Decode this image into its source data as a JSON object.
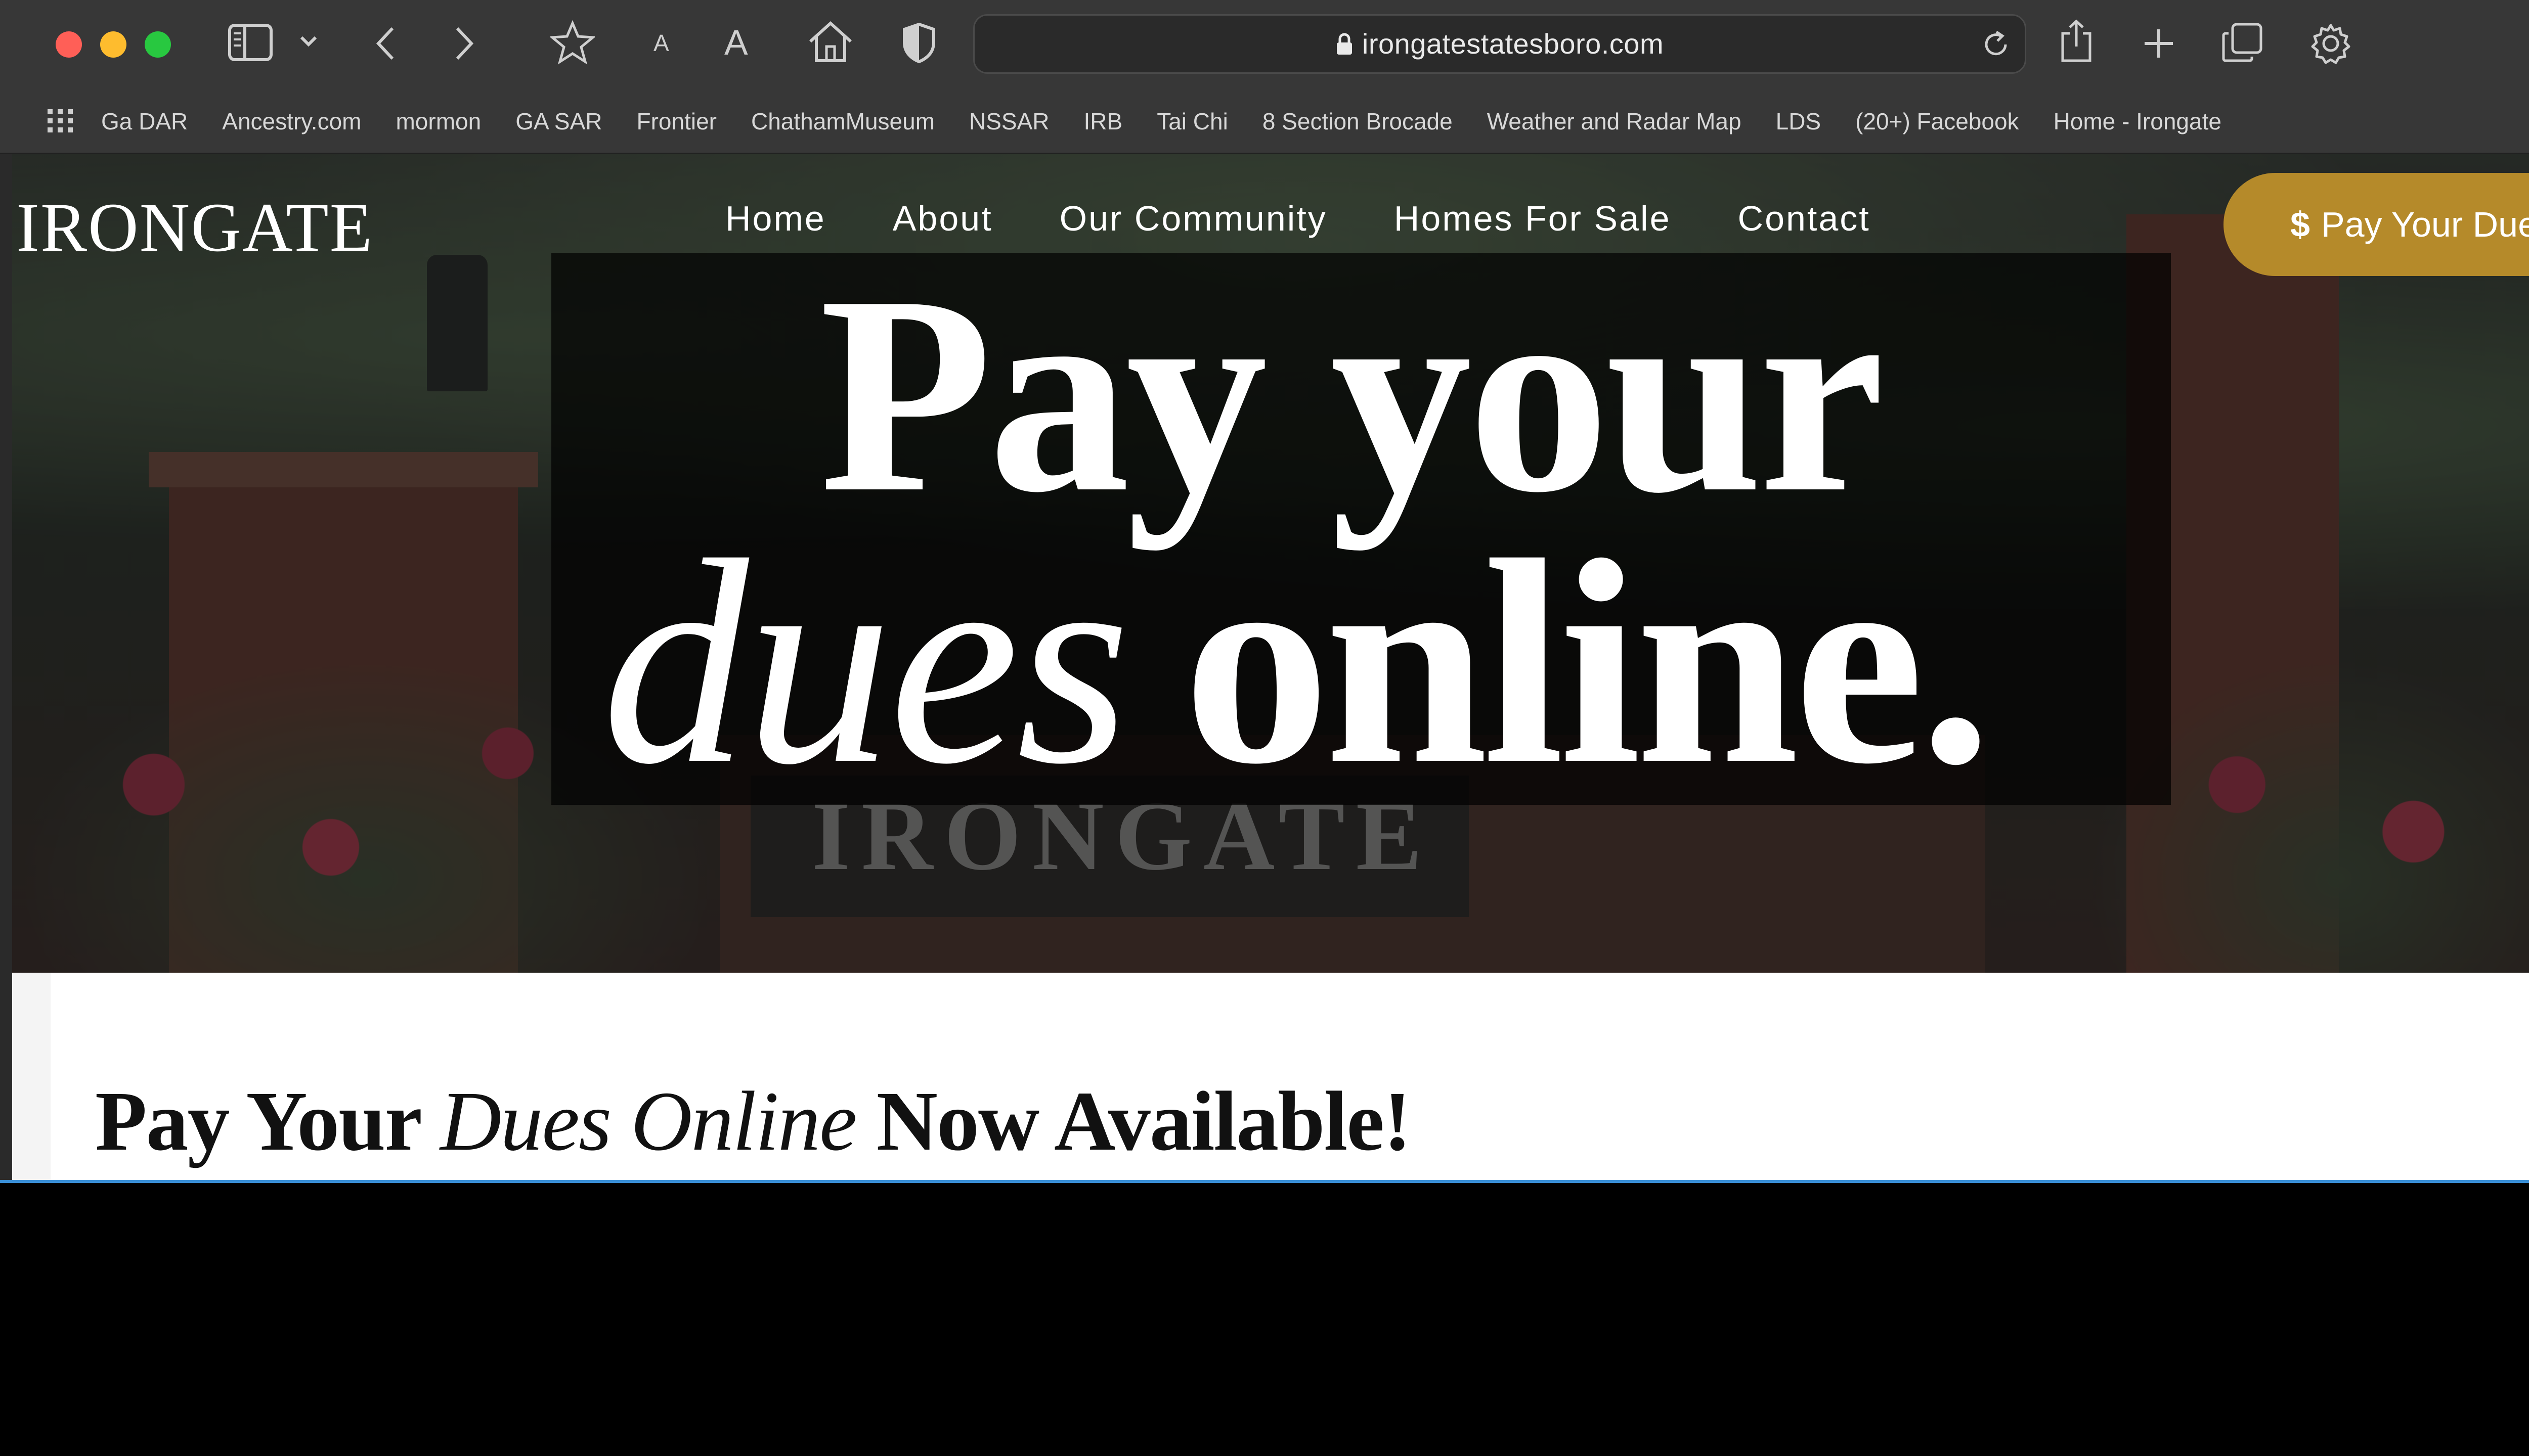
{
  "browser": {
    "url": "irongatestatesboro.com",
    "traffic_lights": {
      "close": "#ff5f57",
      "minimize": "#febc2e",
      "zoom": "#28c840"
    },
    "toolbar_icons": [
      "sidebar-icon",
      "chevron-down-icon",
      "back-icon",
      "forward-icon",
      "star-icon",
      "text-smaller-icon",
      "text-larger-icon",
      "home-icon",
      "shield-icon",
      "reload-icon",
      "share-icon",
      "new-tab-icon",
      "tabs-overview-icon",
      "settings-gear-icon"
    ],
    "text_smaller_label": "A",
    "text_larger_label": "A",
    "bookmarks": [
      "Ga DAR",
      "Ancestry.com",
      "mormon",
      "GA SAR",
      "Frontier",
      "ChathamMuseum",
      "NSSAR",
      "IRB",
      "Tai Chi",
      "8 Section Brocade",
      "Weather and Radar Map",
      "LDS",
      "(20+) Facebook",
      "Home - Irongate"
    ]
  },
  "site": {
    "logo": "IRONGATE",
    "nav": [
      "Home",
      "About",
      "Our Community",
      "Homes For Sale",
      "Contact"
    ],
    "pay_button": {
      "symbol": "$",
      "label": "Pay Your Dues",
      "color": "#b58a2a"
    },
    "banner": {
      "line1": "Pay your",
      "line2_italic": "dues",
      "line2_bold": "online."
    },
    "sign_text": "IRONGATE",
    "headline": {
      "part1": "Pay Your ",
      "italic": "Dues Online",
      "part2": " Now Available!"
    }
  }
}
